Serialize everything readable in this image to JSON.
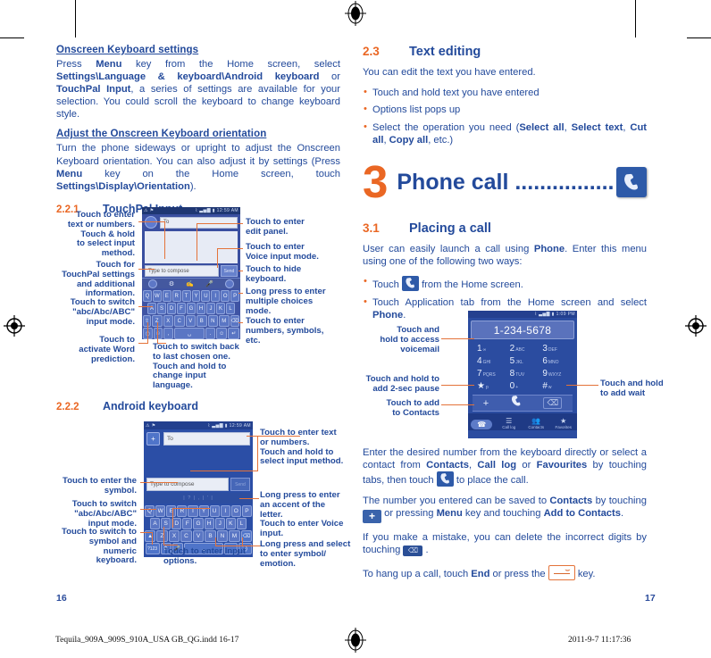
{
  "document": {
    "left_page_number": "16",
    "right_page_number": "17",
    "imprint_left": "Tequila_909A_909S_910A_USA GB_QG.indd   16-17",
    "imprint_right": "2011-9-7   11:17:36"
  },
  "colors": {
    "blue": "#234a9b",
    "orange": "#ea6724",
    "phone_bg": "#27428c",
    "key_fill": "#5a76c4"
  },
  "left_column": {
    "heading1": "Onscreen Keyboard settings",
    "para1": {
      "t1": "Press ",
      "b1": "Menu",
      "t2": " key from the Home screen, select ",
      "b2": "Settings\\Language & keyboard\\Android keyboard",
      "t3": " or ",
      "b3": "TouchPal Input",
      "t4": ", a series of settings are available for your selection. You could scroll the keyboard to change keyboard style."
    },
    "heading2": "Adjust the Onscreen Keyboard orientation",
    "para2": {
      "t1": "Turn the phone sideways or upright to adjust the Onscreen Keyboard orientation. You can also adjust it by settings (Press ",
      "b1": "Menu",
      "t2": " key on the Home screen, touch ",
      "b2": "Settings\\Display\\Orientation",
      "t3": ")."
    },
    "section_221": {
      "number": "2.2.1",
      "title": "TouchPal Input"
    },
    "section_222": {
      "number": "2.2.2",
      "title": "Android keyboard"
    }
  },
  "touchpal_figure": {
    "status_left": "⚠  ⚑",
    "status_right": "⌇  ▃▅▇  ▮  12:59 AM",
    "to_label": "To",
    "compose_placeholder": "Type to compose",
    "send_label": "Send",
    "rows": [
      [
        "Q",
        "W",
        "E",
        "R",
        "T",
        "Y",
        "U",
        "I",
        "O",
        "P"
      ],
      [
        "A",
        "S",
        "D",
        "F",
        "G",
        "H",
        "J",
        "K",
        "L"
      ],
      [
        "Z",
        "X",
        "C",
        "V",
        "B",
        "N",
        "M"
      ]
    ],
    "callouts_left": [
      "Touch to enter\ntext or numbers.\nTouch & hold\nto select input\nmethod.",
      "Touch for\nTouchPal settings\nand additional\ninformation.",
      "Touch to switch\n\"abc/Abc/ABC\"\ninput mode.",
      "Touch to\nactivate Word\nprediction."
    ],
    "callout_word_plain_a": "Touch to",
    "callout_word_plain_b": "activate ",
    "callout_word_bold": "Word",
    "callout_word_plain_c": "prediction.",
    "callouts_right": [
      "Touch to enter\nedit panel.",
      "Touch to enter\nVoice input mode.",
      "Touch to hide\nkeyboard.",
      "Long press to enter\nmultiple choices\nmode.",
      "Touch to enter\nnumbers, symbols,\netc."
    ],
    "callout_bottom": "Touch to switch back\nto last chosen one.\nTouch and hold to\nchange input language."
  },
  "android_figure": {
    "status_left": "⚠  ⚑",
    "status_right": "⌇  ▃▅▇  ▮  12:59 AM",
    "to_label": "To",
    "compose_placeholder": "Type to compose",
    "send_label": "Send",
    "suggestion_row": "|      ?      |      ,      |      '      |",
    "rows": [
      [
        "Q",
        "W",
        "E",
        "R",
        "T",
        "Y",
        "U",
        "I",
        "O",
        "P"
      ],
      [
        "A",
        "S",
        "D",
        "F",
        "G",
        "H",
        "J",
        "K",
        "L"
      ],
      [
        "Z",
        "X",
        "C",
        "V",
        "B",
        "N",
        "M"
      ]
    ],
    "sym_key": "?123",
    "callouts_left": [
      "Touch to enter the\nsymbol.",
      "Touch to switch\n\"abc/Abc/ABC\"\ninput mode.",
      "Touch to switch to\nsymbol and numeric\nkeyboard."
    ],
    "callouts_right": [
      "Touch to enter text\nor numbers.\nTouch and hold to\nselect input method.",
      "Long press to enter\nan accent of the\nletter.",
      "Touch to enter Voice\ninput.",
      "Long press and select\nto enter symbol/\nemotion."
    ],
    "callout_bottom": "Touch to enter Input\noptions."
  },
  "right_column": {
    "section_23": {
      "number": "2.3",
      "title": "Text editing"
    },
    "intro": "You can edit the text you have entered.",
    "bullets": [
      {
        "t1": "Touch and hold text you have entered"
      },
      {
        "t1": "Options list pops up"
      },
      {
        "t1": "Select the operation you need (",
        "b1": "Select all",
        "t2": ", ",
        "b2": "Select text",
        "t3": ", ",
        "b3": "Cut all",
        "t4": ", ",
        "b4": "Copy all",
        "t5": ", etc.)"
      }
    ],
    "chapter": {
      "number": "3",
      "title": "Phone call ................",
      "icon": "phone-handset-icon"
    },
    "section_31": {
      "number": "3.1",
      "title": "Placing a call"
    },
    "para_intro": {
      "t1": "User can easily launch a call using ",
      "b1": "Phone",
      "t2": ". Enter this menu using one of the following two ways:"
    },
    "bullets2": [
      {
        "t1": "Touch ",
        "icon": "phone-handset-icon",
        "t2": " from the Home screen."
      },
      {
        "t1": "Touch Application tab from the Home screen and select ",
        "b1": "Phone",
        "t2": "."
      }
    ],
    "para_enter": {
      "t1": "Enter the desired number from the keyboard directly or select a contact from ",
      "b1": "Contacts",
      "t2": ", ",
      "b2": "Call log",
      "t3": " or ",
      "b3": "Favourites",
      "t4": " by touching tabs, then touch ",
      "icon": "phone-handset-icon",
      "t5": " to place the call."
    },
    "para_save": {
      "t1": "The number you entered can be saved to ",
      "b1": "Contacts",
      "t2": " by touching ",
      "icon": "plus-icon",
      "t3": " or pressing ",
      "b2": "Menu",
      "t4": " key and touching ",
      "b3": "Add to Contacts",
      "t5": "."
    },
    "para_mistake": {
      "t1": "If you make a mistake, you can delete the incorrect digits by touching ",
      "icon": "backspace-icon",
      "t2": " ."
    },
    "para_hangup": {
      "t1": "To hang up a call, touch ",
      "b1": "End",
      "t2": " or press the ",
      "icon": "end-call-key-icon",
      "t3": " key."
    }
  },
  "dialer_figure": {
    "status_right": "⌇  ▃▅▇  ▮  1:09 PM",
    "number_display": "1-234-5678",
    "keys": [
      {
        "digit": "1",
        "letters": "∞"
      },
      {
        "digit": "2",
        "letters": "ABC"
      },
      {
        "digit": "3",
        "letters": "DEF"
      },
      {
        "digit": "4",
        "letters": "GHI"
      },
      {
        "digit": "5",
        "letters": "JKL"
      },
      {
        "digit": "6",
        "letters": "MNO"
      },
      {
        "digit": "7",
        "letters": "PQRS"
      },
      {
        "digit": "8",
        "letters": "TUV"
      },
      {
        "digit": "9",
        "letters": "WXYZ"
      },
      {
        "digit": "★",
        "letters": "p"
      },
      {
        "digit": "0",
        "letters": "+"
      },
      {
        "digit": "#",
        "letters": "w"
      }
    ],
    "action_add": "+",
    "action_call": "call-icon",
    "action_delete": "backspace-icon",
    "tabs": [
      {
        "label": "",
        "icon": "dialer-icon"
      },
      {
        "label": "Call log",
        "icon": "call-log-icon"
      },
      {
        "label": "Contacts",
        "icon": "contacts-icon"
      },
      {
        "label": "Favorites",
        "icon": "star-icon"
      }
    ],
    "callouts_left": [
      "Touch and\nhold to access\nvoicemail",
      "Touch and hold to\nadd 2-sec pause",
      "Touch to add\nto Contacts"
    ],
    "callouts_right": [
      "Touch and hold\nto add wait"
    ]
  }
}
